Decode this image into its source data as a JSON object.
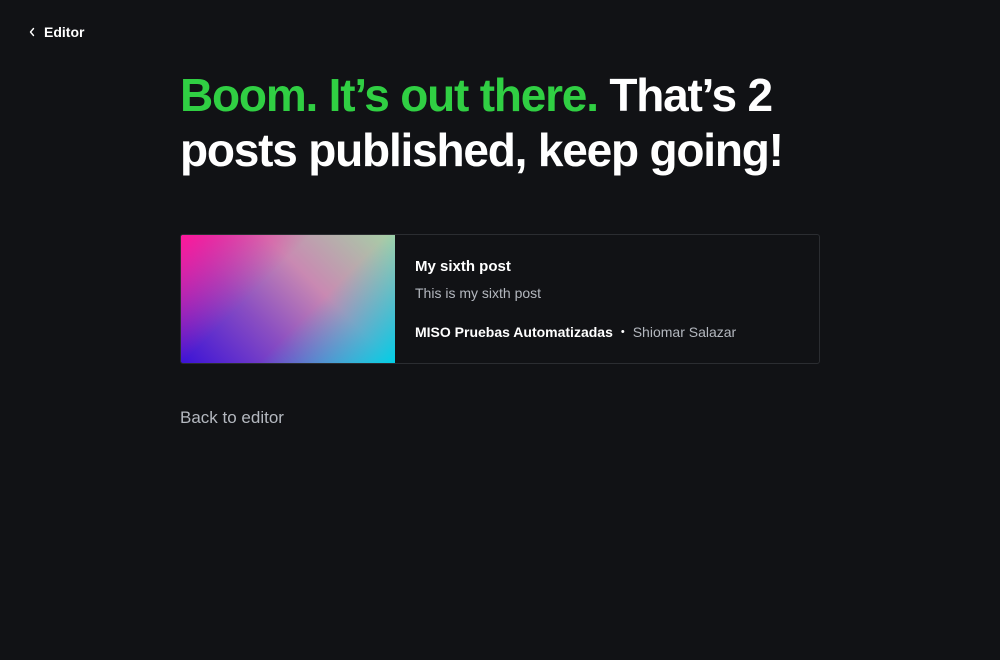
{
  "nav": {
    "back_label": "Editor"
  },
  "headline": {
    "accent": "Boom. It’s out there.",
    "rest": " That’s 2 posts published, keep going!"
  },
  "post": {
    "title": "My sixth post",
    "excerpt": "This is my sixth post",
    "site_name": "MISO Pruebas Automatizadas",
    "separator": "•",
    "author": "Shiomar Salazar"
  },
  "footer": {
    "back_to_editor": "Back to editor"
  },
  "colors": {
    "background": "#111215",
    "accent_green": "#30cf43",
    "muted_text": "#b4b8bf"
  }
}
